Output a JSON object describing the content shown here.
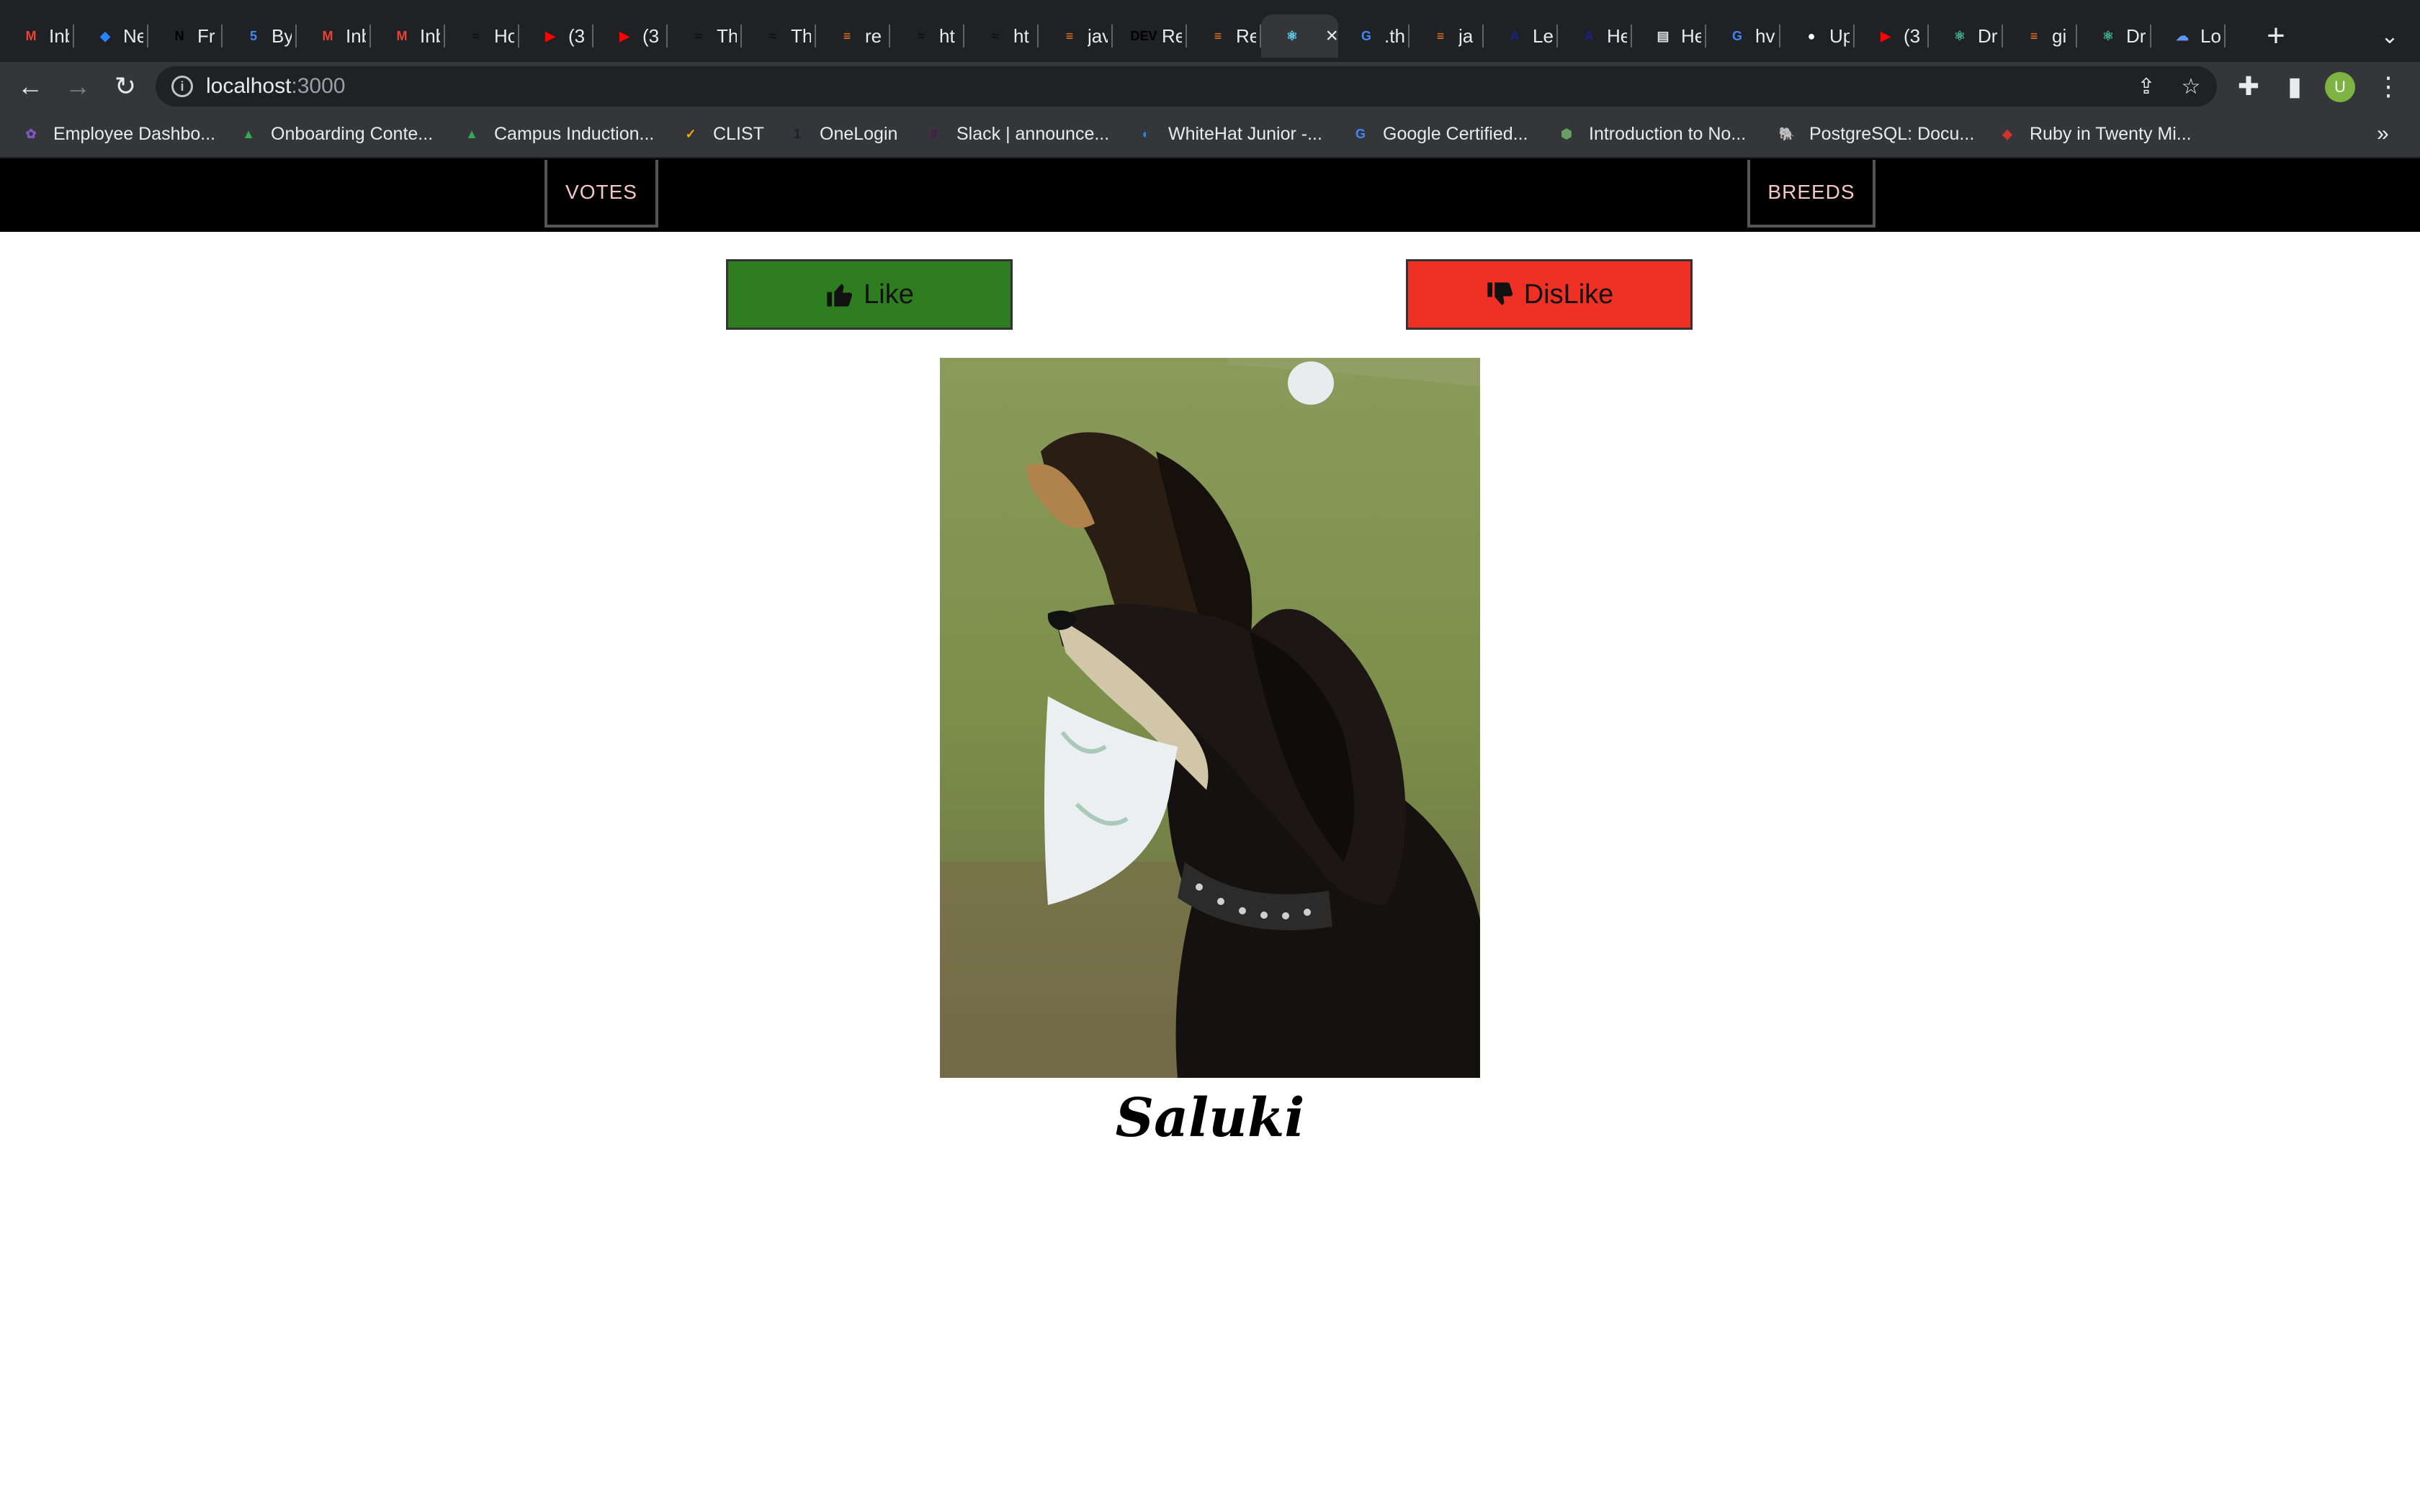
{
  "browser": {
    "tabs": [
      {
        "title": "Inbox",
        "icon": "gmail-icon",
        "color": "#ea4335",
        "glyph": "M"
      },
      {
        "title": "Ne",
        "icon": "jira-icon",
        "color": "#2684ff",
        "glyph": "◆"
      },
      {
        "title": "Fr",
        "icon": "notion-icon",
        "color": "#000000",
        "glyph": "N"
      },
      {
        "title": "By",
        "icon": "doc-icon",
        "color": "#4285f4",
        "glyph": "5"
      },
      {
        "title": "Inbox",
        "icon": "gmail-icon",
        "color": "#ea4335",
        "glyph": "M"
      },
      {
        "title": "Inbox",
        "icon": "gmail-icon",
        "color": "#ea4335",
        "glyph": "M"
      },
      {
        "title": "Ho",
        "icon": "cat-icon",
        "color": "#111111",
        "glyph": "≈"
      },
      {
        "title": "(3",
        "icon": "youtube-icon",
        "color": "#ff0000",
        "glyph": "▶"
      },
      {
        "title": "(3",
        "icon": "youtube-icon",
        "color": "#ff0000",
        "glyph": "▶"
      },
      {
        "title": "Th",
        "icon": "cat-icon",
        "color": "#111111",
        "glyph": "≈"
      },
      {
        "title": "Th",
        "icon": "cat-icon",
        "color": "#111111",
        "glyph": "≈"
      },
      {
        "title": "re",
        "icon": "stackoverflow-icon",
        "color": "#f48024",
        "glyph": "≡"
      },
      {
        "title": "ht",
        "icon": "cat-icon",
        "color": "#111111",
        "glyph": "≈"
      },
      {
        "title": "ht",
        "icon": "cat-icon",
        "color": "#111111",
        "glyph": "≈"
      },
      {
        "title": "jav",
        "icon": "stackoverflow-icon",
        "color": "#f48024",
        "glyph": "≡"
      },
      {
        "title": "Re",
        "icon": "dev-icon",
        "color": "#000000",
        "glyph": "DEV"
      },
      {
        "title": "Re",
        "icon": "stackoverflow-icon",
        "color": "#f48024",
        "glyph": "≡"
      },
      {
        "title": "",
        "icon": "react-icon",
        "color": "#61dafb",
        "glyph": "⚛"
      },
      {
        "title": ".th",
        "icon": "google-icon",
        "color": "#4285f4",
        "glyph": "G"
      },
      {
        "title": "ja",
        "icon": "stackoverflow-icon",
        "color": "#f48024",
        "glyph": "≡"
      },
      {
        "title": "Le",
        "icon": "letter-a-icon",
        "color": "#1a237e",
        "glyph": "A"
      },
      {
        "title": "He",
        "icon": "letter-a-icon",
        "color": "#1a237e",
        "glyph": "A"
      },
      {
        "title": "He",
        "icon": "page-icon",
        "color": "#e0e0e0",
        "glyph": "▤"
      },
      {
        "title": "hv",
        "icon": "google-icon",
        "color": "#4285f4",
        "glyph": "G"
      },
      {
        "title": "Up",
        "icon": "github-icon",
        "color": "#ffffff",
        "glyph": "●"
      },
      {
        "title": "(3",
        "icon": "youtube-icon",
        "color": "#ff0000",
        "glyph": "▶"
      },
      {
        "title": "Dr",
        "icon": "react-icon",
        "color": "#3fb68b",
        "glyph": "⚛"
      },
      {
        "title": "gi",
        "icon": "stackoverflow-icon",
        "color": "#f48024",
        "glyph": "≡"
      },
      {
        "title": "Dr",
        "icon": "react-icon",
        "color": "#3fb68b",
        "glyph": "⚛"
      },
      {
        "title": "Lo",
        "icon": "cloud-icon",
        "color": "#5e97f6",
        "glyph": "☁"
      }
    ],
    "active_tab_index": 17,
    "url_host": "localhost",
    "url_port": ":3000",
    "profile_initial": "U",
    "bookmarks": [
      {
        "label": "Employee Dashbo...",
        "icon": "dashboard-icon",
        "color": "#7e57c2",
        "glyph": "✿"
      },
      {
        "label": "Onboarding Conte...",
        "icon": "drive-icon",
        "color": "#34a853",
        "glyph": "▲"
      },
      {
        "label": "Campus Induction...",
        "icon": "drive-icon",
        "color": "#34a853",
        "glyph": "▲"
      },
      {
        "label": "CLIST",
        "icon": "clist-icon",
        "color": "#f9ab00",
        "glyph": "✓"
      },
      {
        "label": "OneLogin",
        "icon": "onelogin-icon",
        "color": "#1c1f2a",
        "glyph": "1"
      },
      {
        "label": "Slack | announce...",
        "icon": "slack-icon",
        "color": "#4a154b",
        "glyph": "#"
      },
      {
        "label": "WhiteHat Junior -...",
        "icon": "whitehat-icon",
        "color": "#1e88e5",
        "glyph": "◐"
      },
      {
        "label": "Google Certified...",
        "icon": "google-icon",
        "color": "#4285f4",
        "glyph": "G"
      },
      {
        "label": "Introduction to No...",
        "icon": "nodejs-icon",
        "color": "#68a063",
        "glyph": "⬢"
      },
      {
        "label": "PostgreSQL: Docu...",
        "icon": "postgresql-icon",
        "color": "#336791",
        "glyph": "🐘"
      },
      {
        "label": "Ruby in Twenty Mi...",
        "icon": "ruby-icon",
        "color": "#cc342d",
        "glyph": "◆"
      }
    ]
  },
  "page": {
    "nav": {
      "votes_label": "VOTES",
      "breeds_label": "BREEDS"
    },
    "like_label": "Like",
    "dislike_label": "DisLike",
    "breed_name": "Saluki",
    "colors": {
      "like": "#2e7d20",
      "dislike": "#ee3124",
      "navbar": "#000000"
    }
  }
}
